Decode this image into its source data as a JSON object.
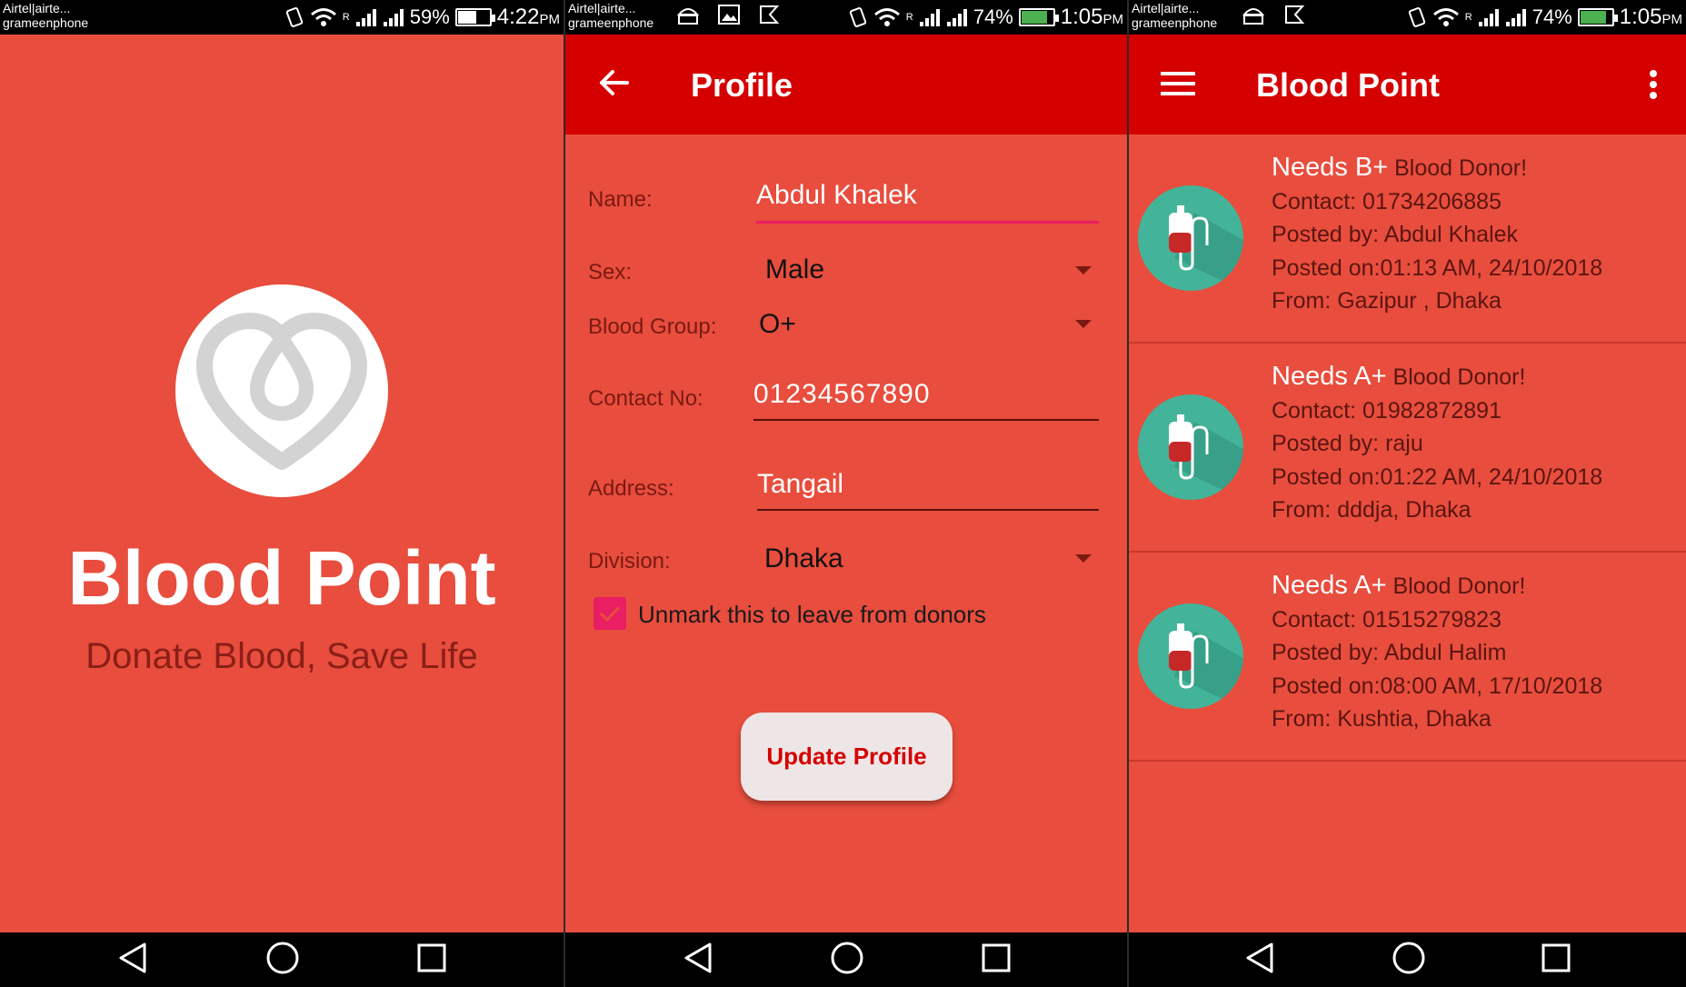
{
  "screen1": {
    "status": {
      "carrier_line1": "Airtel|airte...",
      "carrier_line2": "grameenphone",
      "roaming": "R",
      "battery": "59%",
      "time": "4:22",
      "ampm": "PM"
    },
    "splash": {
      "title": "Blood Point",
      "tagline": "Donate Blood, Save Life"
    }
  },
  "screen2": {
    "status": {
      "carrier_line1": "Airtel|airte...",
      "carrier_line2": "grameenphone",
      "roaming": "R",
      "battery": "74%",
      "time": "1:05",
      "ampm": "PM"
    },
    "toolbar": {
      "title": "Profile"
    },
    "form": {
      "name_label": "Name:",
      "name_value": "Abdul Khalek",
      "sex_label": "Sex:",
      "sex_value": "Male",
      "blood_group_label": "Blood Group:",
      "blood_group_value": "O+",
      "contact_label": "Contact No:",
      "contact_value": "01234567890",
      "address_label": "Address:",
      "address_value": "Tangail",
      "division_label": "Division:",
      "division_value": "Dhaka",
      "checkbox_label": "Unmark this to leave from donors",
      "checkbox_checked": true,
      "update_button": "Update Profile"
    }
  },
  "screen3": {
    "status": {
      "carrier_line1": "Airtel|airte...",
      "carrier_line2": "grameenphone",
      "roaming": "R",
      "battery": "74%",
      "time": "1:05",
      "ampm": "PM"
    },
    "toolbar": {
      "title": "Blood Point"
    },
    "posts": [
      {
        "needs": "Needs B+",
        "donor": "Blood Donor!",
        "contact": "Contact: 01734206885",
        "posted_by": "Posted by: Abdul Khalek",
        "posted_on": "Posted on:01:13 AM, 24/10/2018",
        "from": "From: Gazipur , Dhaka"
      },
      {
        "needs": "Needs A+",
        "donor": "Blood Donor!",
        "contact": "Contact: 01982872891",
        "posted_by": "Posted by: raju",
        "posted_on": "Posted on:01:22 AM, 24/10/2018",
        "from": "From: dddja, Dhaka"
      },
      {
        "needs": "Needs A+",
        "donor": "Blood Donor!",
        "contact": "Contact: 01515279823",
        "posted_by": "Posted by: Abdul Halim",
        "posted_on": "Posted on:08:00 AM, 17/10/2018",
        "from": "From: Kushtia, Dhaka"
      }
    ],
    "fab_icon": "plus-icon"
  },
  "colors": {
    "background": "#e84d3d",
    "toolbar": "#d50000",
    "accent": "#e91e63",
    "item_icon": "#43b49a"
  }
}
